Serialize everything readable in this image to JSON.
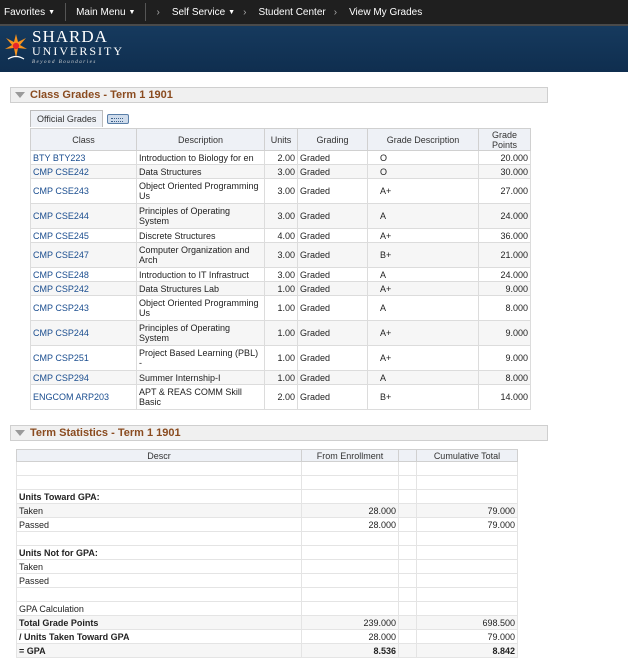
{
  "nav": {
    "favorites": "Favorites",
    "main_menu": "Main Menu",
    "breadcrumbs": [
      "Self Service",
      "Student Center",
      "View My Grades"
    ]
  },
  "brand": {
    "name": "SHARDA",
    "sub": "UNIVERSITY",
    "tagline": "Beyond Boundaries",
    "colors": {
      "navy": "#163a5e",
      "orange": "#f7931e",
      "red": "#e8262a"
    }
  },
  "class_grades": {
    "title": "Class Grades - Term 1 1901",
    "tab_label": "Official Grades",
    "columns": [
      "Class",
      "Description",
      "Units",
      "Grading",
      "Grade Description",
      "Grade Points"
    ],
    "rows": [
      {
        "cls": "BTY BTY223",
        "desc": "Introduction to Biology for en",
        "units": "2.00",
        "grading": "Graded",
        "grade": "O",
        "points": "20.000"
      },
      {
        "cls": "CMP CSE242",
        "desc": "Data Structures",
        "units": "3.00",
        "grading": "Graded",
        "grade": "O",
        "points": "30.000"
      },
      {
        "cls": "CMP CSE243",
        "desc": "Object Oriented Programming Us",
        "units": "3.00",
        "grading": "Graded",
        "grade": "A+",
        "points": "27.000"
      },
      {
        "cls": "CMP CSE244",
        "desc": "Principles of Operating System",
        "units": "3.00",
        "grading": "Graded",
        "grade": "A",
        "points": "24.000"
      },
      {
        "cls": "CMP CSE245",
        "desc": "Discrete Structures",
        "units": "4.00",
        "grading": "Graded",
        "grade": "A+",
        "points": "36.000"
      },
      {
        "cls": "CMP CSE247",
        "desc": "Computer Organization and Arch",
        "units": "3.00",
        "grading": "Graded",
        "grade": "B+",
        "points": "21.000"
      },
      {
        "cls": "CMP CSE248",
        "desc": "Introduction to IT Infrastruct",
        "units": "3.00",
        "grading": "Graded",
        "grade": "A",
        "points": "24.000"
      },
      {
        "cls": "CMP CSP242",
        "desc": "Data Structures Lab",
        "units": "1.00",
        "grading": "Graded",
        "grade": "A+",
        "points": "9.000"
      },
      {
        "cls": "CMP CSP243",
        "desc": "Object Oriented Programming Us",
        "units": "1.00",
        "grading": "Graded",
        "grade": "A",
        "points": "8.000"
      },
      {
        "cls": "CMP CSP244",
        "desc": "Principles of Operating System",
        "units": "1.00",
        "grading": "Graded",
        "grade": "A+",
        "points": "9.000"
      },
      {
        "cls": "CMP CSP251",
        "desc": "Project Based Learning (PBL) -",
        "units": "1.00",
        "grading": "Graded",
        "grade": "A+",
        "points": "9.000"
      },
      {
        "cls": "CMP CSP294",
        "desc": "Summer Internship-I",
        "units": "1.00",
        "grading": "Graded",
        "grade": "A",
        "points": "8.000"
      },
      {
        "cls": "ENGCOM ARP203",
        "desc": "APT & REAS COMM Skill Basic",
        "units": "2.00",
        "grading": "Graded",
        "grade": "B+",
        "points": "14.000"
      }
    ]
  },
  "term_stats": {
    "title": "Term Statistics - Term 1 1901",
    "columns": [
      "Descr",
      "From Enrollment",
      "Cumulative Total"
    ],
    "rows": [
      {
        "label": "",
        "from": "",
        "cum": "",
        "bold": false
      },
      {
        "label": "",
        "from": "",
        "cum": "",
        "bold": false
      },
      {
        "label": "Units Toward GPA:",
        "from": "",
        "cum": "",
        "bold": true
      },
      {
        "label": "Taken",
        "from": "28.000",
        "cum": "79.000",
        "bold": false
      },
      {
        "label": "Passed",
        "from": "28.000",
        "cum": "79.000",
        "bold": false
      },
      {
        "label": "",
        "from": "",
        "cum": "",
        "bold": false
      },
      {
        "label": "Units Not for GPA:",
        "from": "",
        "cum": "",
        "bold": true
      },
      {
        "label": "Taken",
        "from": "",
        "cum": "",
        "bold": false
      },
      {
        "label": "Passed",
        "from": "",
        "cum": "",
        "bold": false
      },
      {
        "label": "",
        "from": "",
        "cum": "",
        "bold": false
      },
      {
        "label": "GPA Calculation",
        "from": "",
        "cum": "",
        "bold": false
      },
      {
        "label": "Total Grade Points",
        "from": "239.000",
        "cum": "698.500",
        "bold": true
      },
      {
        "label": "/  Units Taken Toward GPA",
        "from": "28.000",
        "cum": "79.000",
        "bold": true
      },
      {
        "label": "= GPA",
        "from": "8.536",
        "cum": "8.842",
        "bold": true
      }
    ]
  }
}
